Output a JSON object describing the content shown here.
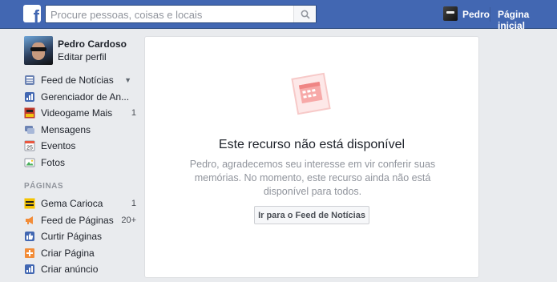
{
  "topbar": {
    "logo": "f",
    "search_placeholder": "Procure pessoas, coisas e locais",
    "user_name": "Pedro",
    "home_label": "Página inicial"
  },
  "profile": {
    "name": "Pedro Cardoso",
    "edit_label": "Editar perfil"
  },
  "nav": {
    "items": [
      {
        "label": "Feed de Notícias",
        "icon": "news-feed-icon"
      },
      {
        "label": "Gerenciador de An...",
        "icon": "ads-manager-icon"
      },
      {
        "label": "Videogame Mais",
        "count": "1",
        "icon": "page-thumbnail-icon"
      },
      {
        "label": "Mensagens",
        "icon": "messages-icon"
      },
      {
        "label": "Eventos",
        "icon": "events-icon",
        "icon_text": "25"
      },
      {
        "label": "Fotos",
        "icon": "photos-icon"
      }
    ]
  },
  "pages_section": {
    "title": "PÁGINAS",
    "items": [
      {
        "label": "Gema Carioca",
        "count": "1",
        "icon": "page-thumbnail-icon"
      },
      {
        "label": "Feed de Páginas",
        "count": "20+",
        "icon": "megaphone-icon"
      },
      {
        "label": "Curtir Páginas",
        "icon": "like-pages-icon"
      },
      {
        "label": "Criar Página",
        "icon": "create-page-icon"
      },
      {
        "label": "Criar anúncio",
        "icon": "create-ad-icon"
      }
    ]
  },
  "main": {
    "title": "Este recurso não está disponível",
    "message": "Pedro, agradecemos seu interesse em vir conferir suas memórias. No momento, este recurso ainda não está disponível para todos.",
    "button_label": "Ir para o Feed de Notícias"
  },
  "colors": {
    "brand": "#4267b2",
    "background": "#e9ebee",
    "illustration": "#f7a9a8"
  }
}
